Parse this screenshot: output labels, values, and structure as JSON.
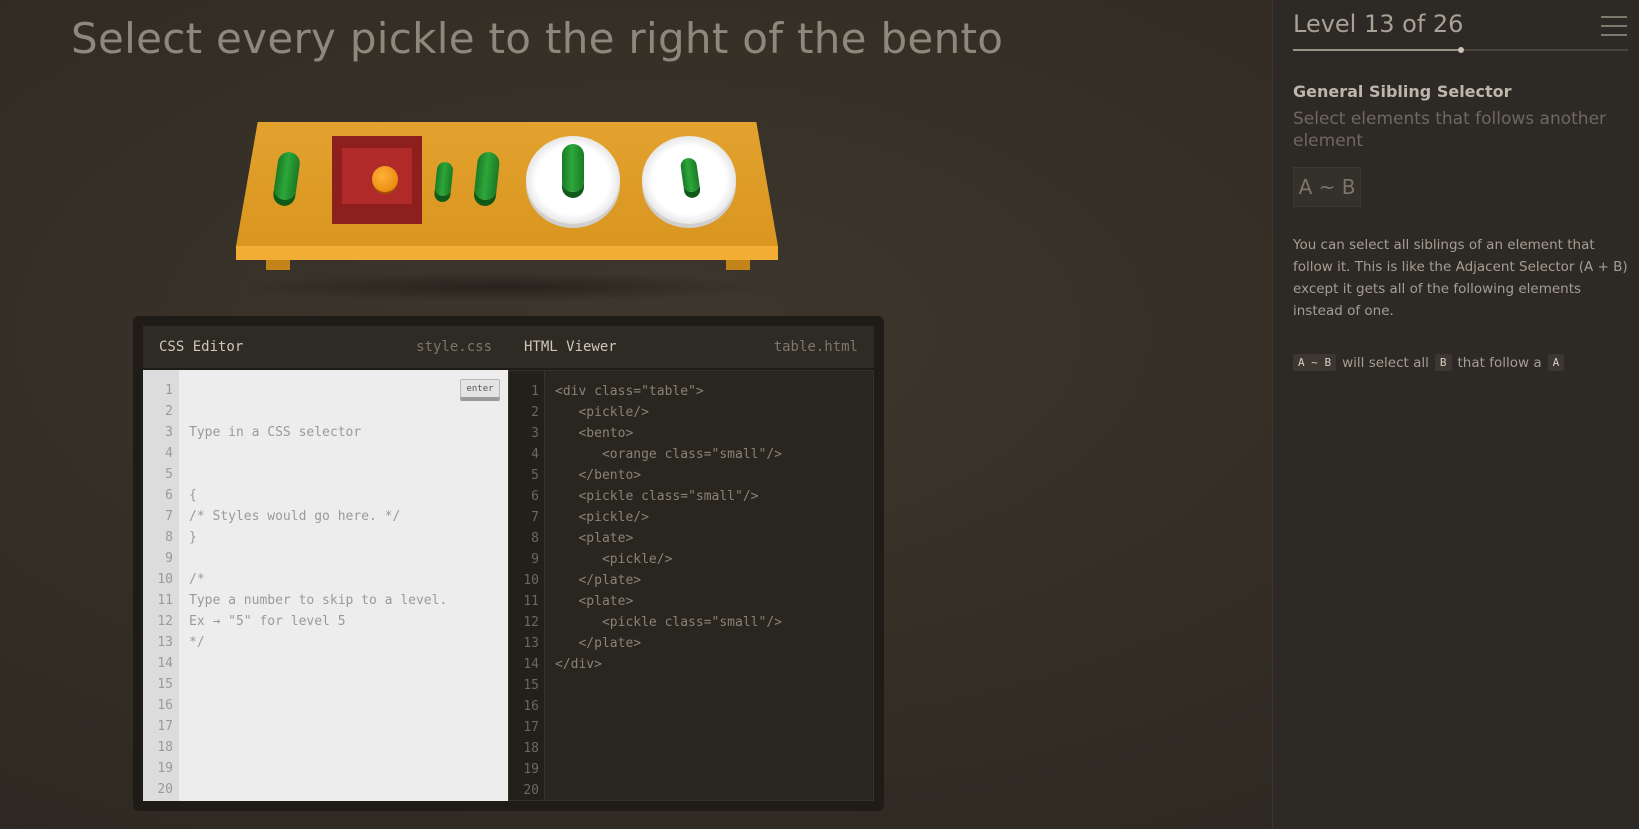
{
  "instruction": "Select every pickle to the right of the bento",
  "editor": {
    "css_title": "CSS Editor",
    "css_file": "style.css",
    "html_title": "HTML Viewer",
    "html_file": "table.html",
    "enter_label": "enter",
    "css_placeholder": "Type in a CSS selector",
    "css_lines": [
      "{",
      "/* Styles would go here. */",
      "}",
      "",
      "/*",
      "Type a number to skip to a level.",
      "Ex → \"5\" for level 5",
      "*/"
    ],
    "html_lines": [
      "<div class=\"table\">",
      "   <pickle/>",
      "   <bento>",
      "      <orange class=\"small\"/>",
      "   </bento>",
      "   <pickle class=\"small\"/>",
      "   <pickle/>",
      "   <plate>",
      "      <pickle/>",
      "   </plate>",
      "   <plate>",
      "      <pickle class=\"small\"/>",
      "   </plate>",
      "</div>"
    ],
    "line_count": 20
  },
  "sidebar": {
    "level_title": "Level 13 of 26",
    "progress": 0.5,
    "selector_name": "General Sibling Selector",
    "selector_title": "Select elements that follows another element",
    "syntax": "A ~ B",
    "description": "You can select all siblings of an element that follow it. This is like the Adjacent Selector (A + B) except it gets all of the following elements instead of one.",
    "example": {
      "code1": "A ~ B",
      "text1": "will select all",
      "code2": "B",
      "text2": "that follow a",
      "code3": "A"
    }
  }
}
